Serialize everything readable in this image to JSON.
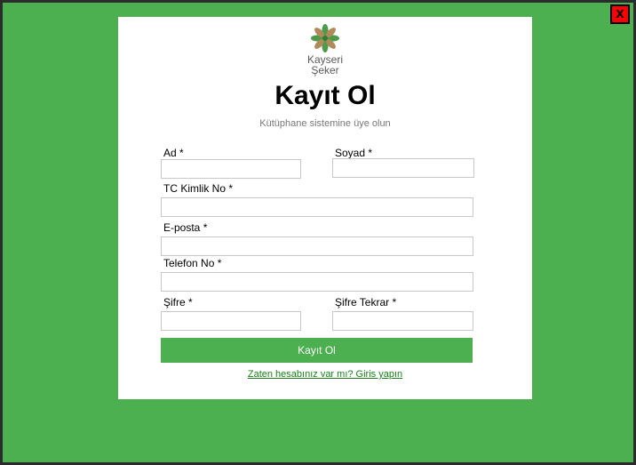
{
  "window": {
    "close_label": "X"
  },
  "brand": {
    "line1": "Kayseri",
    "line2": "Şeker",
    "icon": "leaf-flower-logo-icon"
  },
  "form": {
    "title": "Kayıt Ol",
    "subtitle": "Kütüphane sistemine üye olun",
    "fields": {
      "ad": {
        "label": "Ad *",
        "value": ""
      },
      "soyad": {
        "label": "Soyad *",
        "value": ""
      },
      "tc": {
        "label": "TC Kimlik No *",
        "value": ""
      },
      "email": {
        "label": "E-posta *",
        "value": ""
      },
      "phone": {
        "label": "Telefon No *",
        "value": ""
      },
      "password": {
        "label": "Şifre *",
        "value": ""
      },
      "password_repeat": {
        "label": "Şifre Tekrar *",
        "value": ""
      }
    },
    "submit_label": "Kayıt Ol",
    "login_link": "Zaten hesabınız var mı? Giris yapın"
  },
  "colors": {
    "background": "#4caf50",
    "card": "#ffffff",
    "button": "#4caf50",
    "close_button": "#ff0000",
    "link": "#1a7f1a"
  }
}
